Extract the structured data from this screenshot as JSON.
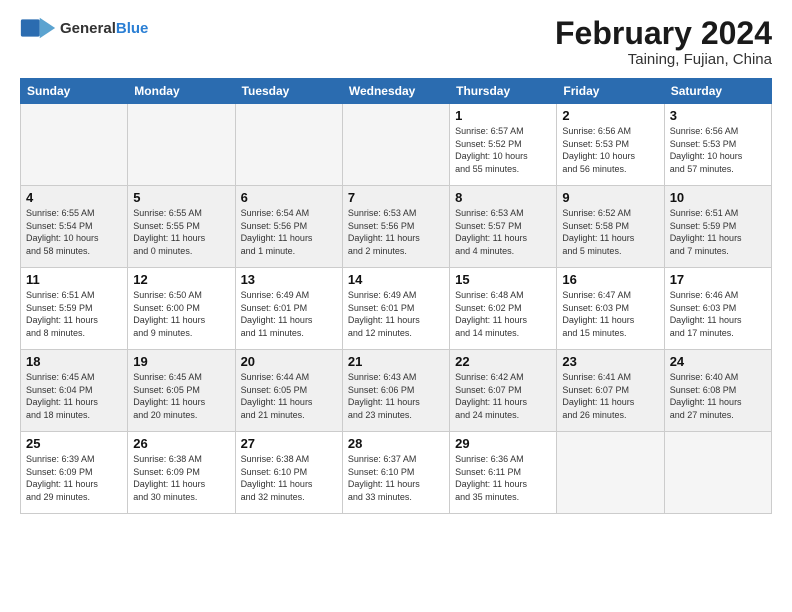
{
  "header": {
    "logo_general": "General",
    "logo_blue": "Blue",
    "month_title": "February 2024",
    "location": "Taining, Fujian, China"
  },
  "days_of_week": [
    "Sunday",
    "Monday",
    "Tuesday",
    "Wednesday",
    "Thursday",
    "Friday",
    "Saturday"
  ],
  "weeks": [
    {
      "shade": false,
      "days": [
        {
          "num": "",
          "info": ""
        },
        {
          "num": "",
          "info": ""
        },
        {
          "num": "",
          "info": ""
        },
        {
          "num": "",
          "info": ""
        },
        {
          "num": "1",
          "info": "Sunrise: 6:57 AM\nSunset: 5:52 PM\nDaylight: 10 hours\nand 55 minutes."
        },
        {
          "num": "2",
          "info": "Sunrise: 6:56 AM\nSunset: 5:53 PM\nDaylight: 10 hours\nand 56 minutes."
        },
        {
          "num": "3",
          "info": "Sunrise: 6:56 AM\nSunset: 5:53 PM\nDaylight: 10 hours\nand 57 minutes."
        }
      ]
    },
    {
      "shade": true,
      "days": [
        {
          "num": "4",
          "info": "Sunrise: 6:55 AM\nSunset: 5:54 PM\nDaylight: 10 hours\nand 58 minutes."
        },
        {
          "num": "5",
          "info": "Sunrise: 6:55 AM\nSunset: 5:55 PM\nDaylight: 11 hours\nand 0 minutes."
        },
        {
          "num": "6",
          "info": "Sunrise: 6:54 AM\nSunset: 5:56 PM\nDaylight: 11 hours\nand 1 minute."
        },
        {
          "num": "7",
          "info": "Sunrise: 6:53 AM\nSunset: 5:56 PM\nDaylight: 11 hours\nand 2 minutes."
        },
        {
          "num": "8",
          "info": "Sunrise: 6:53 AM\nSunset: 5:57 PM\nDaylight: 11 hours\nand 4 minutes."
        },
        {
          "num": "9",
          "info": "Sunrise: 6:52 AM\nSunset: 5:58 PM\nDaylight: 11 hours\nand 5 minutes."
        },
        {
          "num": "10",
          "info": "Sunrise: 6:51 AM\nSunset: 5:59 PM\nDaylight: 11 hours\nand 7 minutes."
        }
      ]
    },
    {
      "shade": false,
      "days": [
        {
          "num": "11",
          "info": "Sunrise: 6:51 AM\nSunset: 5:59 PM\nDaylight: 11 hours\nand 8 minutes."
        },
        {
          "num": "12",
          "info": "Sunrise: 6:50 AM\nSunset: 6:00 PM\nDaylight: 11 hours\nand 9 minutes."
        },
        {
          "num": "13",
          "info": "Sunrise: 6:49 AM\nSunset: 6:01 PM\nDaylight: 11 hours\nand 11 minutes."
        },
        {
          "num": "14",
          "info": "Sunrise: 6:49 AM\nSunset: 6:01 PM\nDaylight: 11 hours\nand 12 minutes."
        },
        {
          "num": "15",
          "info": "Sunrise: 6:48 AM\nSunset: 6:02 PM\nDaylight: 11 hours\nand 14 minutes."
        },
        {
          "num": "16",
          "info": "Sunrise: 6:47 AM\nSunset: 6:03 PM\nDaylight: 11 hours\nand 15 minutes."
        },
        {
          "num": "17",
          "info": "Sunrise: 6:46 AM\nSunset: 6:03 PM\nDaylight: 11 hours\nand 17 minutes."
        }
      ]
    },
    {
      "shade": true,
      "days": [
        {
          "num": "18",
          "info": "Sunrise: 6:45 AM\nSunset: 6:04 PM\nDaylight: 11 hours\nand 18 minutes."
        },
        {
          "num": "19",
          "info": "Sunrise: 6:45 AM\nSunset: 6:05 PM\nDaylight: 11 hours\nand 20 minutes."
        },
        {
          "num": "20",
          "info": "Sunrise: 6:44 AM\nSunset: 6:05 PM\nDaylight: 11 hours\nand 21 minutes."
        },
        {
          "num": "21",
          "info": "Sunrise: 6:43 AM\nSunset: 6:06 PM\nDaylight: 11 hours\nand 23 minutes."
        },
        {
          "num": "22",
          "info": "Sunrise: 6:42 AM\nSunset: 6:07 PM\nDaylight: 11 hours\nand 24 minutes."
        },
        {
          "num": "23",
          "info": "Sunrise: 6:41 AM\nSunset: 6:07 PM\nDaylight: 11 hours\nand 26 minutes."
        },
        {
          "num": "24",
          "info": "Sunrise: 6:40 AM\nSunset: 6:08 PM\nDaylight: 11 hours\nand 27 minutes."
        }
      ]
    },
    {
      "shade": false,
      "days": [
        {
          "num": "25",
          "info": "Sunrise: 6:39 AM\nSunset: 6:09 PM\nDaylight: 11 hours\nand 29 minutes."
        },
        {
          "num": "26",
          "info": "Sunrise: 6:38 AM\nSunset: 6:09 PM\nDaylight: 11 hours\nand 30 minutes."
        },
        {
          "num": "27",
          "info": "Sunrise: 6:38 AM\nSunset: 6:10 PM\nDaylight: 11 hours\nand 32 minutes."
        },
        {
          "num": "28",
          "info": "Sunrise: 6:37 AM\nSunset: 6:10 PM\nDaylight: 11 hours\nand 33 minutes."
        },
        {
          "num": "29",
          "info": "Sunrise: 6:36 AM\nSunset: 6:11 PM\nDaylight: 11 hours\nand 35 minutes."
        },
        {
          "num": "",
          "info": ""
        },
        {
          "num": "",
          "info": ""
        }
      ]
    }
  ]
}
